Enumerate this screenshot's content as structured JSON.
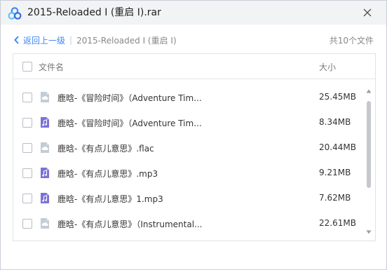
{
  "window": {
    "title": "2015-Reloaded I (重启 I).rar"
  },
  "nav": {
    "back_label": "返回上一级",
    "separator": "|",
    "current": "2015-Reloaded I (重启 I)"
  },
  "file_count": "共10个文件",
  "list": {
    "header": {
      "name_label": "文件名",
      "size_label": "大小"
    },
    "rows": [
      {
        "name": "鹿晗-《冒险时间》（Adventure Tim...",
        "size": "25.45MB",
        "icon": "cloud-file-icon"
      },
      {
        "name": "鹿晗-《冒险时间》（Adventure Tim...",
        "size": "8.34MB",
        "icon": "music-file-icon"
      },
      {
        "name": "鹿晗-《有点儿意思》.flac",
        "size": "20.44MB",
        "icon": "cloud-file-icon"
      },
      {
        "name": "鹿晗-《有点儿意思》.mp3",
        "size": "9.21MB",
        "icon": "music-file-icon"
      },
      {
        "name": "鹿晗-《有点儿意思》1.mp3",
        "size": "7.62MB",
        "icon": "music-file-icon"
      },
      {
        "name": "鹿晗-《有点儿意思》（Instrumental...",
        "size": "22.61MB",
        "icon": "cloud-file-icon"
      }
    ]
  },
  "colors": {
    "accent": "#3f88f4",
    "music_icon": "#7b72d6",
    "cloud_icon": "#c4ccd6"
  }
}
